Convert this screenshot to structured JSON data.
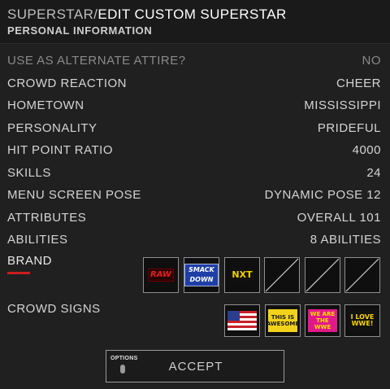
{
  "header": {
    "breadcrumb_parent": "SUPERSTAR",
    "breadcrumb_separator": "/",
    "breadcrumb_current": "EDIT CUSTOM SUPERSTAR",
    "section": "PERSONAL INFORMATION"
  },
  "settings": [
    {
      "label": "USE AS ALTERNATE ATTIRE?",
      "value": "NO",
      "dimmed": true
    },
    {
      "label": "CROWD REACTION",
      "value": "CHEER"
    },
    {
      "label": "HOMETOWN",
      "value": "MISSISSIPPI"
    },
    {
      "label": "PERSONALITY",
      "value": "PRIDEFUL"
    },
    {
      "label": "HIT POINT RATIO",
      "value": "4000"
    },
    {
      "label": "SKILLS",
      "value": "24"
    },
    {
      "label": "MENU SCREEN POSE",
      "value": "DYNAMIC POSE 12"
    },
    {
      "label": "ATTRIBUTES",
      "value": "OVERALL 101"
    },
    {
      "label": "ABILITIES",
      "value": "8 ABILITIES"
    }
  ],
  "brand": {
    "label": "BRAND",
    "selected_indicator_color": "#c81e1e",
    "slots": [
      {
        "type": "logo",
        "icon": "raw-logo-icon",
        "text": "RAW"
      },
      {
        "type": "logo",
        "icon": "smackdown-logo-icon",
        "text": "SMACK DOWN"
      },
      {
        "type": "logo",
        "icon": "nxt-logo-icon",
        "text": "NXT"
      },
      {
        "type": "empty",
        "icon": "empty-slot-icon"
      },
      {
        "type": "empty",
        "icon": "empty-slot-icon"
      },
      {
        "type": "empty",
        "icon": "empty-slot-icon"
      }
    ]
  },
  "crowd_signs": {
    "label": "CROWD SIGNS",
    "signs": [
      {
        "icon": "usa-flag-sign-icon",
        "text": ""
      },
      {
        "icon": "this-is-awesome-sign-icon",
        "text": "THIS IS AWESOME"
      },
      {
        "icon": "we-are-the-wwe-sign-icon",
        "text": "WE ARE THE WWE"
      },
      {
        "icon": "i-love-wwe-sign-icon",
        "text": "I LOVE WWE!"
      }
    ]
  },
  "footer": {
    "options_label": "OPTIONS",
    "accept_label": "ACCEPT"
  }
}
